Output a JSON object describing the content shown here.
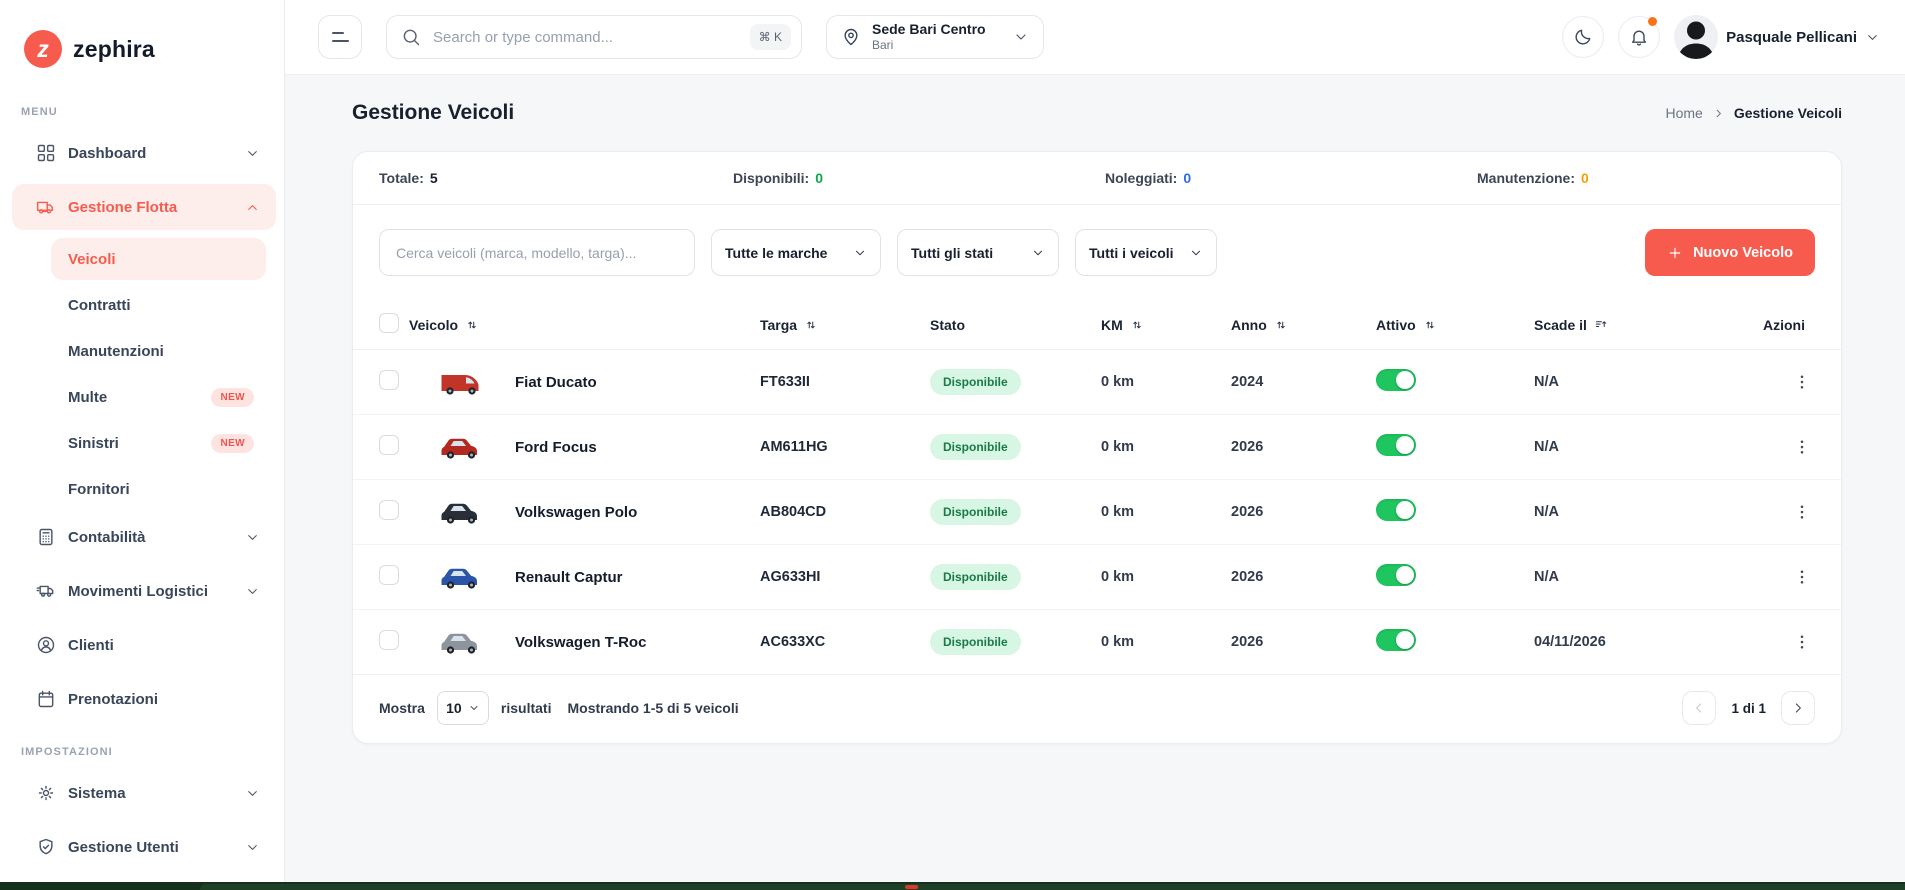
{
  "brand": {
    "name": "zephira",
    "logo_letter": "z"
  },
  "colors": {
    "accent": "#f75b4d",
    "toggle_on": "#1fc55f",
    "status_pill_bg": "#d7f6e4",
    "status_pill_text": "#1a7a4a",
    "notification_dot": "#f97316"
  },
  "sidebar": {
    "menu_label": "MENU",
    "settings_label": "IMPOSTAZIONI",
    "menu_items": [
      {
        "label": "Dashboard",
        "icon": "grid",
        "chevron": "down",
        "active": false
      },
      {
        "label": "Gestione Flotta",
        "icon": "truck",
        "chevron": "up",
        "active": true,
        "children": [
          {
            "label": "Veicoli",
            "active": true
          },
          {
            "label": "Contratti"
          },
          {
            "label": "Manutenzioni"
          },
          {
            "label": "Multe",
            "badge": "NEW"
          },
          {
            "label": "Sinistri",
            "badge": "NEW"
          },
          {
            "label": "Fornitori"
          }
        ]
      },
      {
        "label": "Contabilità",
        "icon": "calculator",
        "chevron": "down",
        "active": false
      },
      {
        "label": "Movimenti Logistici",
        "icon": "logistics-truck",
        "chevron": "down",
        "active": false
      },
      {
        "label": "Clienti",
        "icon": "user",
        "active": false
      },
      {
        "label": "Prenotazioni",
        "icon": "calendar",
        "active": false
      }
    ],
    "settings_items": [
      {
        "label": "Sistema",
        "icon": "gear",
        "chevron": "down",
        "active": false
      },
      {
        "label": "Gestione Utenti",
        "icon": "shield-check",
        "chevron": "down",
        "active": false
      }
    ]
  },
  "topbar": {
    "search_placeholder": "Search or type command...",
    "search_shortcut": "⌘ K",
    "location_name": "Sede Bari Centro",
    "location_city": "Bari",
    "user_name": "Pasquale Pellicani"
  },
  "page": {
    "title": "Gestione Veicoli",
    "breadcrumb_home": "Home",
    "breadcrumb_current": "Gestione Veicoli"
  },
  "stats": [
    {
      "label": "Totale:",
      "value": "5",
      "value_color": "#18202f"
    },
    {
      "label": "Disponibili:",
      "value": "0",
      "value_color": "#0ea653"
    },
    {
      "label": "Noleggiati:",
      "value": "0",
      "value_color": "#2e6be6"
    },
    {
      "label": "Manutenzione:",
      "value": "0",
      "value_color": "#f59e0b"
    }
  ],
  "filters": {
    "search_placeholder": "Cerca veicoli (marca, modello, targa)...",
    "brand_select": "Tutte le marche",
    "status_select": "Tutti gli stati",
    "type_select": "Tutti i veicoli",
    "new_vehicle_button": "Nuovo Veicolo"
  },
  "table": {
    "columns": [
      {
        "label": "Veicolo",
        "sort": "both"
      },
      {
        "label": "Targa",
        "sort": "both"
      },
      {
        "label": "Stato",
        "sort": "none"
      },
      {
        "label": "KM",
        "sort": "both"
      },
      {
        "label": "Anno",
        "sort": "both"
      },
      {
        "label": "Attivo",
        "sort": "both"
      },
      {
        "label": "Scade il",
        "sort": "asc"
      },
      {
        "label": "Azioni",
        "sort": "none"
      }
    ],
    "rows": [
      {
        "vehicle": "Fiat Ducato",
        "thumb": "van",
        "thumb_color": "#c23427",
        "plate": "FT633II",
        "status": "Disponibile",
        "km": "0 km",
        "year": "2024",
        "active": true,
        "expires": "N/A"
      },
      {
        "vehicle": "Ford Focus",
        "thumb": "car",
        "thumb_color": "#b4291f",
        "plate": "AM611HG",
        "status": "Disponibile",
        "km": "0 km",
        "year": "2026",
        "active": true,
        "expires": "N/A"
      },
      {
        "vehicle": "Volkswagen Polo",
        "thumb": "car",
        "thumb_color": "#2a2e36",
        "plate": "AB804CD",
        "status": "Disponibile",
        "km": "0 km",
        "year": "2026",
        "active": true,
        "expires": "N/A"
      },
      {
        "vehicle": "Renault Captur",
        "thumb": "car",
        "thumb_color": "#2b55a8",
        "plate": "AG633HI",
        "status": "Disponibile",
        "km": "0 km",
        "year": "2026",
        "active": true,
        "expires": "N/A"
      },
      {
        "vehicle": "Volkswagen T-Roc",
        "thumb": "car",
        "thumb_color": "#8d949c",
        "plate": "AC633XC",
        "status": "Disponibile",
        "km": "0 km",
        "year": "2026",
        "active": true,
        "expires": "04/11/2026"
      }
    ]
  },
  "pagination": {
    "show_label": "Mostra",
    "per_page": "10",
    "results_label": "risultati",
    "range_text": "Mostrando 1-5 di 5 veicoli",
    "page_indicator": "1 di 1"
  }
}
